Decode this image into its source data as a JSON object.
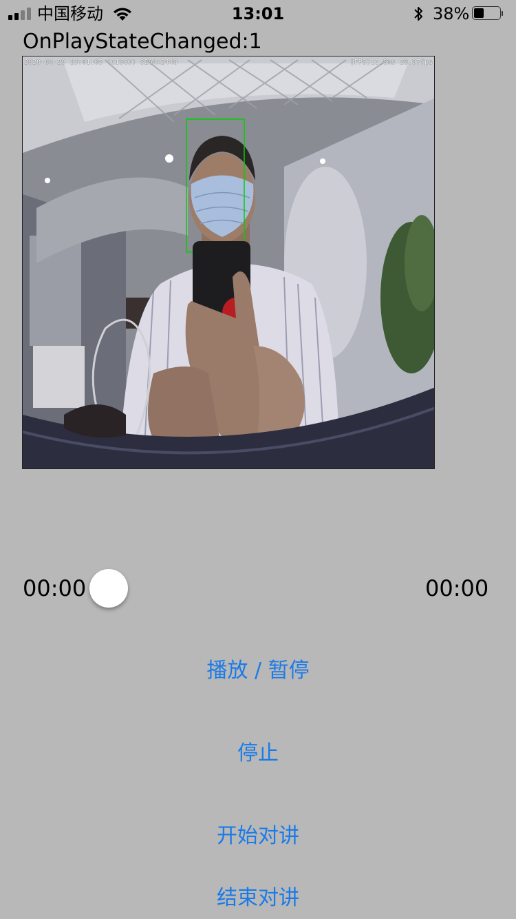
{
  "status_bar": {
    "carrier": "中国移动",
    "time": "13:01",
    "battery_percent": "38%",
    "battery_level": 0.38,
    "signal_bars_filled": 2,
    "signal_bars_total": 4
  },
  "player": {
    "state_text": "OnPlayStateChanged:1",
    "osd_left": "2020-04-29 13:01:05 (CISCO) 3264x2448",
    "osd_right": "[FPS]11.8ms 28.97fps",
    "current_time": "00:00",
    "total_time": "00:00",
    "progress": 0
  },
  "buttons": {
    "play_pause": "播放 / 暂停",
    "stop": "停止",
    "start_talk": "开始对讲",
    "end_talk": "结束对讲"
  },
  "colors": {
    "background": "#b8b8b8",
    "button_text": "#1a7ae8",
    "face_box": "#00d000"
  }
}
